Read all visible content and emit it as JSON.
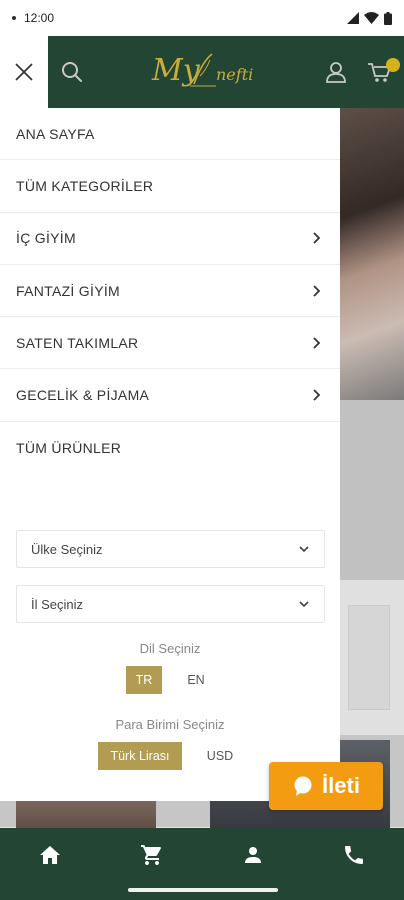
{
  "status_bar": {
    "time": "12:00"
  },
  "header": {
    "logo_text_left": "My",
    "logo_text_right": "nefti"
  },
  "menu": {
    "items": [
      {
        "label": "ANA SAYFA",
        "has_chevron": false
      },
      {
        "label": "TÜM KATEGORİLER",
        "has_chevron": false
      },
      {
        "label": "İÇ GİYİM",
        "has_chevron": true
      },
      {
        "label": "FANTAZİ GİYİM",
        "has_chevron": true
      },
      {
        "label": "SATEN TAKIMLAR",
        "has_chevron": true
      },
      {
        "label": "GECELİK & PİJAMA",
        "has_chevron": true
      },
      {
        "label": "TÜM ÜRÜNLER",
        "has_chevron": false
      }
    ]
  },
  "country_select": {
    "value": "Ülke Seçiniz"
  },
  "city_select": {
    "value": "İl Seçiniz"
  },
  "language": {
    "title": "Dil Seçiniz",
    "options": [
      "TR",
      "EN"
    ],
    "selected": "TR"
  },
  "currency": {
    "title": "Para Birimi Seçiniz",
    "options": [
      "Türk Lirası",
      "USD"
    ],
    "selected": "Türk Lirası"
  },
  "chat": {
    "label": "İleti"
  },
  "colors": {
    "brand_green": "#234634",
    "gold": "#b19c52",
    "chat_orange": "#f39c12"
  }
}
